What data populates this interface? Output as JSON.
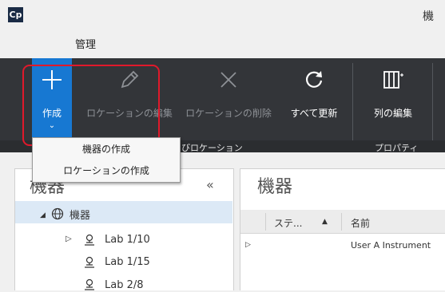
{
  "app": {
    "logo_text": "Cp",
    "title": "機"
  },
  "tabs": [
    {
      "label": "管理"
    }
  ],
  "ribbon": {
    "buttons": [
      {
        "label": "作成",
        "icon": "plus-icon",
        "enabled": true
      },
      {
        "label": "ロケーションの編集",
        "icon": "pencil-icon",
        "enabled": false
      },
      {
        "label": "ロケーションの削除",
        "icon": "x-icon",
        "enabled": false
      },
      {
        "label": "すべて更新",
        "icon": "refresh-icon",
        "enabled": true
      },
      {
        "label": "列の編集",
        "icon": "columns-icon",
        "enabled": true
      }
    ],
    "groups": [
      {
        "label": "びロケーション"
      },
      {
        "label": "プロパティ"
      }
    ]
  },
  "dropdown": {
    "items": [
      "機器の作成",
      "ロケーションの作成"
    ]
  },
  "left_panel": {
    "title": "機器",
    "collapse_icon": "«",
    "tree": [
      {
        "label": "機器",
        "icon": "globe-icon",
        "expander": "◢"
      },
      {
        "label": "Lab 1/10",
        "icon": "location-pin-icon",
        "expander": "▷"
      },
      {
        "label": "Lab 1/15",
        "icon": "location-pin-icon",
        "expander": ""
      },
      {
        "label": "Lab 2/8",
        "icon": "location-pin-icon",
        "expander": ""
      }
    ]
  },
  "right_panel": {
    "title": "機器",
    "columns": [
      {
        "label": "ステ...",
        "sort": "▲"
      },
      {
        "label": "名前"
      }
    ],
    "rows": [
      {
        "expander": "▷",
        "name": "User A Instrument"
      }
    ]
  },
  "colors": {
    "ribbon_bg": "#333539",
    "accent": "#1778d2",
    "highlight": "#e0192b",
    "selection": "#dce9f6"
  }
}
